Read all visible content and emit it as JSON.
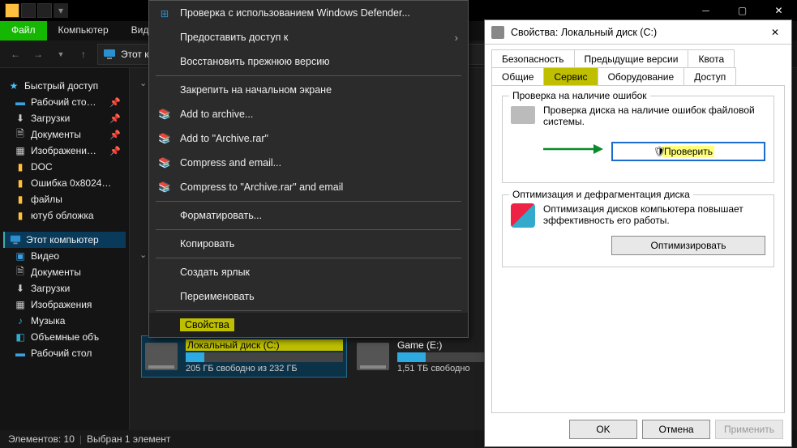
{
  "ribbon": {
    "file": "Файл",
    "computer": "Компьютер",
    "view": "Вид"
  },
  "address": {
    "text": "Этот к"
  },
  "sidebar": {
    "quick": "Быстрый доступ",
    "items": [
      {
        "label": "Рабочий сто…",
        "pin": true,
        "color": "#3aa0e0"
      },
      {
        "label": "Загрузки",
        "pin": true,
        "color": "#ccc"
      },
      {
        "label": "Документы",
        "pin": true,
        "color": "#ccc"
      },
      {
        "label": "Изображени…",
        "pin": true,
        "color": "#ccc"
      },
      {
        "label": "DOC",
        "pin": false,
        "color": "#ffc040"
      },
      {
        "label": "Ошибка 0x8024…",
        "pin": false,
        "color": "#ffc040"
      },
      {
        "label": "файлы",
        "pin": false,
        "color": "#ffc040"
      },
      {
        "label": "ютуб обложка",
        "pin": false,
        "color": "#ffc040"
      }
    ],
    "thispc": "Этот компьютер",
    "pcitems": [
      {
        "label": "Видео"
      },
      {
        "label": "Документы"
      },
      {
        "label": "Загрузки"
      },
      {
        "label": "Изображения"
      },
      {
        "label": "Музыка"
      },
      {
        "label": "Объемные объ"
      },
      {
        "label": "Рабочий стол"
      }
    ]
  },
  "drives": {
    "c": {
      "name": "Локальный диск (C:)",
      "free": "205 ГБ свободно из 232 ГБ",
      "pct": 12
    },
    "e": {
      "name": "Game (E:)",
      "free": "1,51 ТБ свободно",
      "pct": 18
    }
  },
  "ctx": {
    "defender": "Проверка с использованием Windows Defender...",
    "share": "Предоставить доступ к",
    "restore": "Восстановить прежнюю версию",
    "pin_start": "Закрепить на начальном экране",
    "add_archive": "Add to archive...",
    "add_rar": "Add to \"Archive.rar\"",
    "compress_email": "Compress and email...",
    "compress_rar_email": "Compress to \"Archive.rar\" and email",
    "format": "Форматировать...",
    "copy": "Копировать",
    "shortcut": "Создать ярлык",
    "rename": "Переименовать",
    "properties": "Свойства"
  },
  "dialog": {
    "title": "Свойства: Локальный диск (C:)",
    "tabs": {
      "security": "Безопасность",
      "prev": "Предыдущие версии",
      "quota": "Квота",
      "general": "Общие",
      "service": "Сервис",
      "hardware": "Оборудование",
      "access": "Доступ"
    },
    "check_group": "Проверка на наличие ошибок",
    "check_text": "Проверка диска на наличие ошибок файловой системы.",
    "check_btn": "Проверить",
    "defrag_group": "Оптимизация и дефрагментация диска",
    "defrag_text": "Оптимизация дисков компьютера повышает эффективность его работы.",
    "defrag_btn": "Оптимизировать",
    "ok": "OK",
    "cancel": "Отмена",
    "apply": "Применить"
  },
  "status": {
    "items": "Элементов: 10",
    "sel": "Выбран 1 элемент"
  }
}
